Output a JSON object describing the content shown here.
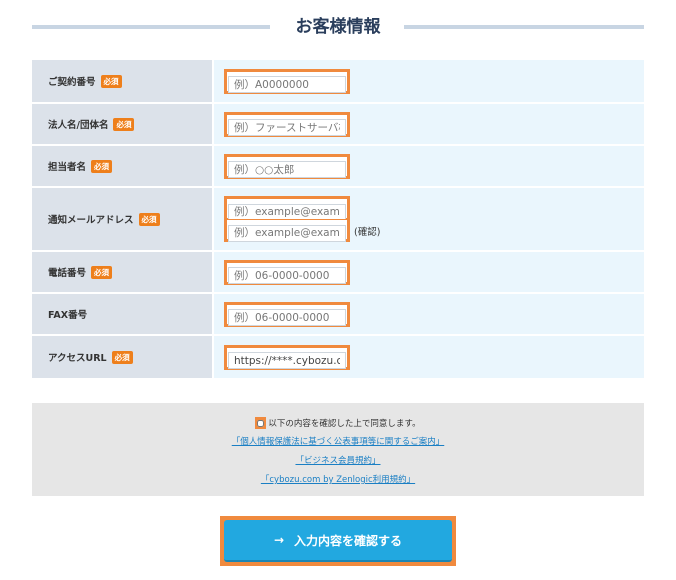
{
  "section": {
    "title": "お客様情報"
  },
  "required_badge": "必須",
  "fields": [
    {
      "label": "ご契約番号",
      "required": true,
      "placeholder": "例）A0000000"
    },
    {
      "label": "法人名/団体名",
      "required": true,
      "placeholder": "例）ファーストサーバ株式"
    },
    {
      "label": "担当者名",
      "required": true,
      "placeholder": "例）○○太郎"
    },
    {
      "label": "通知メールアドレス",
      "required": true,
      "placeholder": "例）example@example.c",
      "confirm_placeholder": "例）example@example.c",
      "confirm_label": "(確認)"
    },
    {
      "label": "電話番号",
      "required": true,
      "placeholder": "例）06-0000-0000"
    },
    {
      "label": "FAX番号",
      "required": false,
      "placeholder": "例）06-0000-0000"
    },
    {
      "label": "アクセスURL",
      "required": true,
      "value": "https://****.cybozu.com/"
    }
  ],
  "agreement": {
    "checkbox_label": "以下の内容を確認した上で同意します。",
    "checked": false,
    "links": [
      "「個人情報保護法に基づく公表事項等に関するご案内」",
      "「ビジネス会員規約」",
      "「cybozu.com by Zenlogic利用規約」"
    ]
  },
  "submit": {
    "arrow_icon": "→",
    "label": "入力内容を確認する"
  },
  "colors": {
    "accent_orange": "#ee7f1b",
    "highlight_frame": "#f08a3e",
    "button_blue": "#22a8e0",
    "link_blue": "#1a7fc4"
  }
}
